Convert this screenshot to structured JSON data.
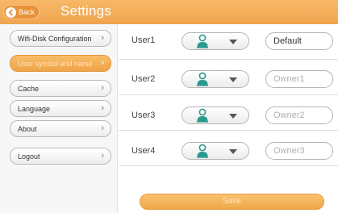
{
  "header": {
    "back_label": "Back",
    "title": "Settings"
  },
  "sidebar": {
    "items": [
      {
        "label": "Wifi-Disk Configuration",
        "active": false
      },
      {
        "label": "User symbol and name",
        "active": true
      },
      {
        "label": "Cache",
        "active": false
      },
      {
        "label": "Language",
        "active": false
      },
      {
        "label": "About",
        "active": false
      },
      {
        "label": "Logout",
        "active": false
      }
    ],
    "chevron": "›"
  },
  "users": [
    {
      "label": "User1",
      "avatar": "person-icon",
      "name_value": "Default",
      "name_placeholder": ""
    },
    {
      "label": "User2",
      "avatar": "person-icon",
      "name_value": "",
      "name_placeholder": "Owner1"
    },
    {
      "label": "User3",
      "avatar": "person-icon",
      "name_value": "",
      "name_placeholder": "Owner2"
    },
    {
      "label": "User4",
      "avatar": "person-icon",
      "name_value": "",
      "name_placeholder": "Owner3"
    }
  ],
  "save_label": "Save",
  "colors": {
    "accent": "#f0a54f",
    "avatar": "#2a9a8c"
  }
}
